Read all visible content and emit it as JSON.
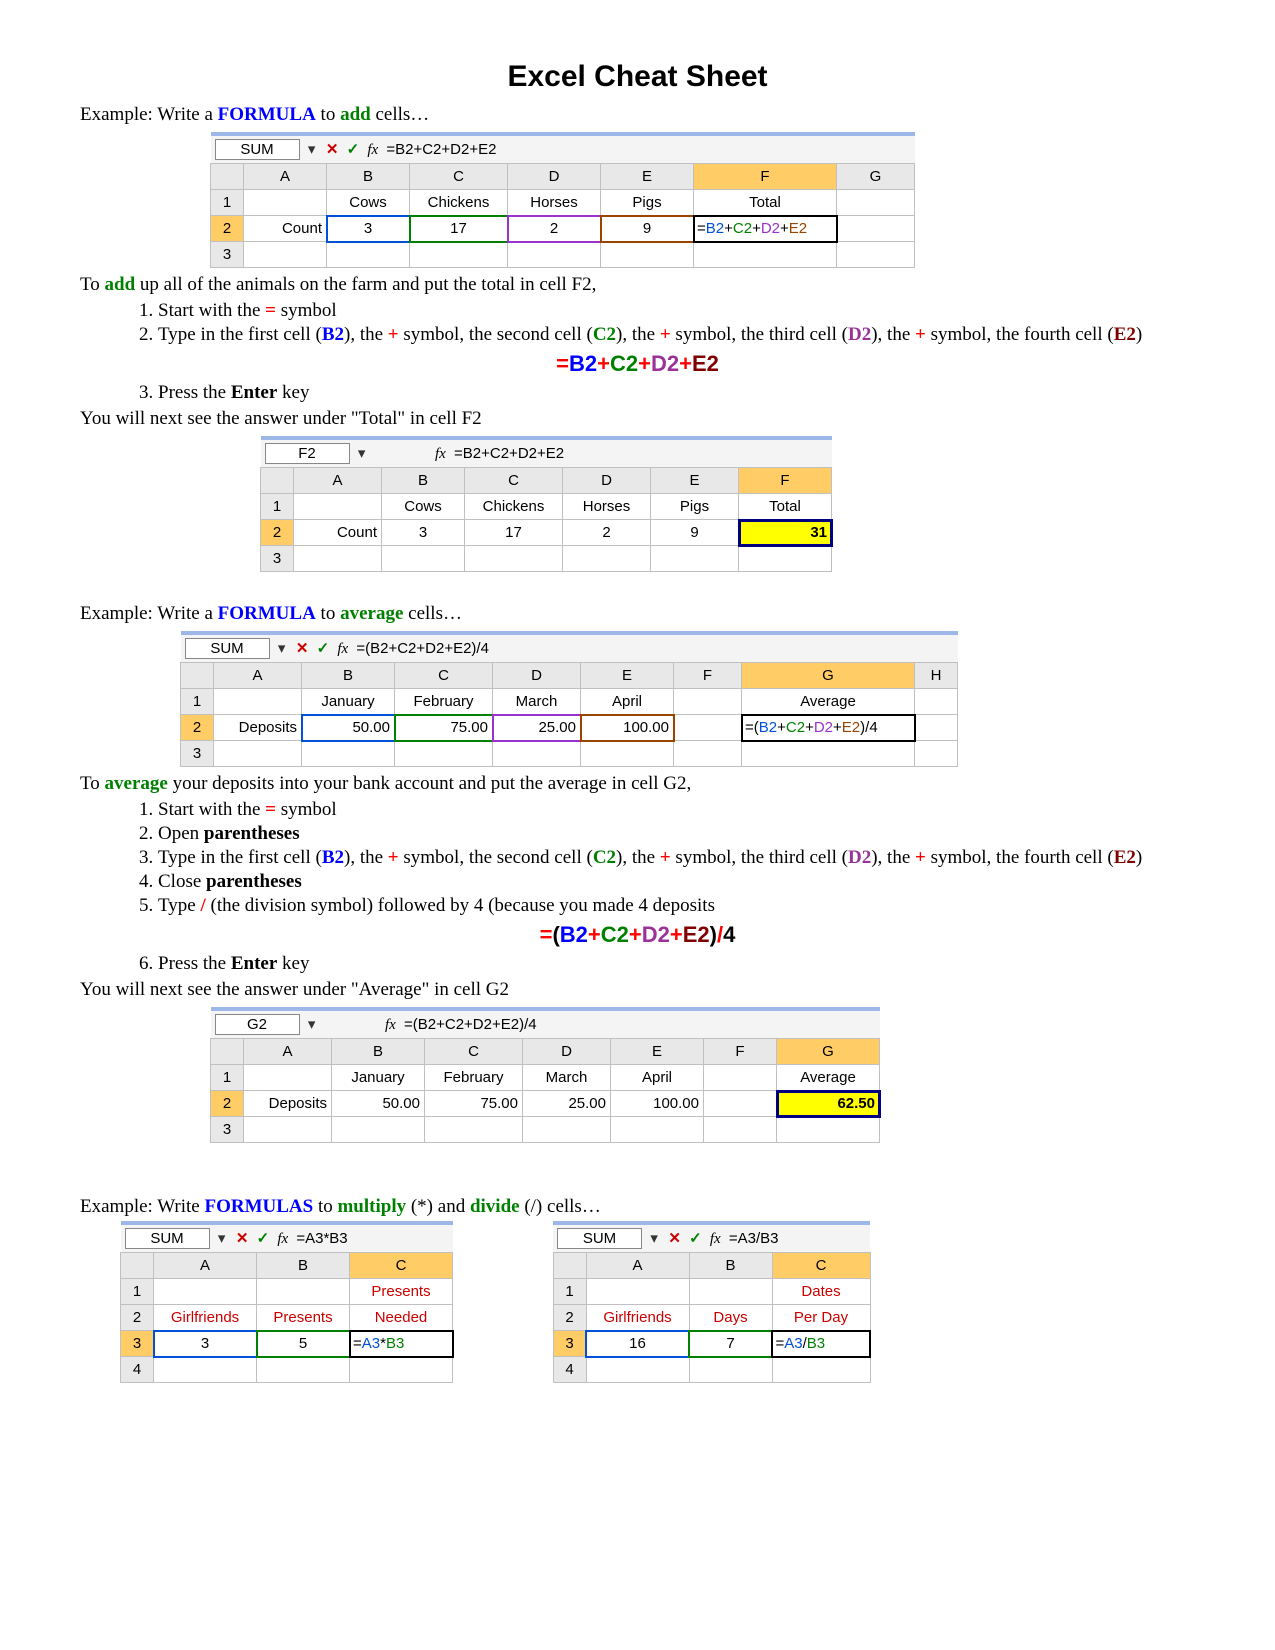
{
  "title": "Excel Cheat Sheet",
  "ex1": {
    "intro_pre": "Example: Write a ",
    "intro_formula": "FORMULA",
    "intro_mid": " to ",
    "intro_action": "add",
    "intro_post": " cells…",
    "namebox": "SUM",
    "formula": "=B2+C2+D2+E2",
    "cols": [
      "A",
      "B",
      "C",
      "D",
      "E",
      "F",
      "G"
    ],
    "row1": [
      "",
      "Cows",
      "Chickens",
      "Horses",
      "Pigs",
      "Total",
      ""
    ],
    "row2_label": "Count",
    "row2": [
      "3",
      "17",
      "2",
      "9"
    ],
    "row2_formula": "=B2+C2+D2+E2",
    "expl_line": "To add up all of the animals on the farm and put the total in cell F2,",
    "step1_a": "Start with the ",
    "step1_b": "=",
    "step1_c": " symbol",
    "step2": [
      "Type in the first cell (",
      "B2",
      "), the ",
      "+",
      " symbol, the second cell (",
      "C2",
      "), the ",
      "+",
      " symbol, the third cell (",
      "D2",
      "), the ",
      "+",
      " symbol, the fourth cell (",
      "E2",
      ")"
    ],
    "big_eq": "=",
    "big_b2": "B2",
    "big_p": "+",
    "big_c2": "C2",
    "big_d2": "D2",
    "big_e2": "E2",
    "step3_a": "Press the ",
    "step3_b": "Enter",
    "step3_c": " key",
    "result_line": "You will next see the answer under \"Total\" in cell F2"
  },
  "ex1r": {
    "namebox": "F2",
    "formula": "=B2+C2+D2+E2",
    "cols": [
      "A",
      "B",
      "C",
      "D",
      "E",
      "F"
    ],
    "row1": [
      "",
      "Cows",
      "Chickens",
      "Horses",
      "Pigs",
      "Total"
    ],
    "row2_label": "Count",
    "row2": [
      "3",
      "17",
      "2",
      "9"
    ],
    "total": "31"
  },
  "ex2": {
    "intro_pre": "Example: Write a ",
    "intro_formula": "FORMULA",
    "intro_mid": " to ",
    "intro_action": "average",
    "intro_post": " cells…",
    "namebox": "SUM",
    "formula": "=(B2+C2+D2+E2)/4",
    "cols": [
      "A",
      "B",
      "C",
      "D",
      "E",
      "F",
      "G",
      "H"
    ],
    "row1": [
      "",
      "January",
      "February",
      "March",
      "April",
      "",
      "Average",
      ""
    ],
    "row2_label": "Deposits",
    "row2": [
      "50.00",
      "75.00",
      "25.00",
      "100.00"
    ],
    "row2_formula": "=(B2+C2+D2+E2)/4",
    "expl_line": "To average your deposits into your bank account and put the average in cell G2,",
    "step1_a": "Start with the ",
    "step1_b": "=",
    "step1_c": " symbol",
    "step2_a": "Open ",
    "step2_b": "parentheses",
    "step3": [
      "Type in the first cell (",
      "B2",
      "), the ",
      "+",
      " symbol, the second cell (",
      "C2",
      "), the ",
      "+",
      " symbol, the third cell (",
      "D2",
      "), the ",
      "+",
      " symbol, the fourth cell (",
      "E2",
      ")"
    ],
    "step4_a": "Close ",
    "step4_b": "parentheses",
    "step5_a": "Type ",
    "step5_b": "/",
    "step5_c": " (the division symbol) followed by 4 (because you made 4 deposits",
    "big_eq": "=",
    "big_lp": "(",
    "big_b2": "B2",
    "big_p": "+",
    "big_c2": "C2",
    "big_d2": "D2",
    "big_e2": "E2",
    "big_rp": ")",
    "big_slash": "/",
    "big_4": "4",
    "step6_a": "Press the ",
    "step6_b": "Enter",
    "step6_c": " key",
    "result_line": "You will next see the answer under \"Average\" in cell G2"
  },
  "ex2r": {
    "namebox": "G2",
    "formula": "=(B2+C2+D2+E2)/4",
    "cols": [
      "A",
      "B",
      "C",
      "D",
      "E",
      "F",
      "G"
    ],
    "row1": [
      "",
      "January",
      "February",
      "March",
      "April",
      "",
      "Average"
    ],
    "row2_label": "Deposits",
    "row2": [
      "50.00",
      "75.00",
      "25.00",
      "100.00"
    ],
    "total": "62.50"
  },
  "ex3": {
    "intro_pre": "Example: Write ",
    "intro_formula": "FORMULAS",
    "intro_mid1": " to ",
    "intro_action1": "multiply",
    "intro_paren1": " (*) and ",
    "intro_action2": "divide",
    "intro_paren2": " (/) cells…"
  },
  "mul": {
    "namebox": "SUM",
    "formula": "=A3*B3",
    "cols": [
      "A",
      "B",
      "C"
    ],
    "r1": [
      "",
      "",
      "Presents"
    ],
    "r2": [
      "Girlfriends",
      "Presents",
      "Needed"
    ],
    "r3": [
      "3",
      "5",
      "=A3*B3"
    ]
  },
  "div": {
    "namebox": "SUM",
    "formula": "=A3/B3",
    "cols": [
      "A",
      "B",
      "C"
    ],
    "r1": [
      "",
      "",
      "Dates"
    ],
    "r2": [
      "Girlfriends",
      "Days",
      "Per Day"
    ],
    "r3": [
      "16",
      "7",
      "=A3/B3"
    ]
  }
}
